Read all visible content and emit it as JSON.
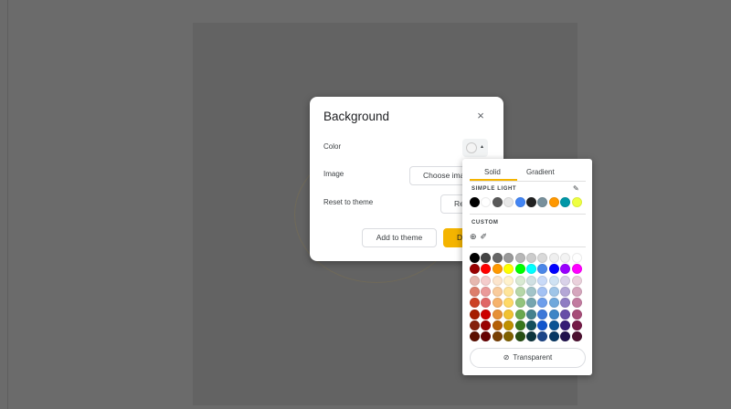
{
  "dialog": {
    "title": "Background",
    "close_icon": "×",
    "rows": {
      "color_label": "Color",
      "image_label": "Image",
      "reset_label": "Reset to theme"
    },
    "choose_image_label": "Choose ima",
    "reset_button_label": "Re",
    "add_to_theme_label": "Add to theme",
    "done_label": "D",
    "caret": "▴"
  },
  "picker": {
    "tabs": [
      "Solid",
      "Gradient"
    ],
    "simple_light_heading": "SIMPLE LIGHT",
    "pencil_icon": "✎",
    "theme_colors": [
      "#000000",
      "#ffffff",
      "#595959",
      "#e8e8e8",
      "#4285f4",
      "#212121",
      "#78909c",
      "#ff9800",
      "#0097a7",
      "#eeff41"
    ],
    "custom_heading": "CUSTOM",
    "add_custom_icon": "⊕",
    "eyedropper_icon": "✐",
    "grid": [
      [
        "#000000",
        "#434343",
        "#666666",
        "#999999",
        "#b7b7b7",
        "#cccccc",
        "#d9d9d9",
        "#efefef",
        "#f3f3f3",
        "#ffffff"
      ],
      [
        "#980000",
        "#ff0000",
        "#ff9900",
        "#ffff00",
        "#00ff00",
        "#00ffff",
        "#4a86e8",
        "#0000ff",
        "#9900ff",
        "#ff00ff"
      ],
      [
        "#e6b8af",
        "#f4cccc",
        "#fce5cd",
        "#fff2cc",
        "#d9ead3",
        "#d0e0e3",
        "#c9daf8",
        "#cfe2f3",
        "#d9d2e9",
        "#ead1dc"
      ],
      [
        "#dd7e6b",
        "#ea9999",
        "#f9cb9c",
        "#ffe599",
        "#b6d7a8",
        "#a2c4c9",
        "#a4c2f4",
        "#9fc5e8",
        "#b4a7d6",
        "#d5a6bd"
      ],
      [
        "#cc4125",
        "#e06666",
        "#f6b26b",
        "#ffd966",
        "#93c47d",
        "#76a5af",
        "#6d9eeb",
        "#6fa8dc",
        "#8e7cc3",
        "#c27ba0"
      ],
      [
        "#a61c00",
        "#cc0000",
        "#e69138",
        "#f1c232",
        "#6aa84f",
        "#45818e",
        "#3c78d8",
        "#3d85c6",
        "#674ea7",
        "#a64d79"
      ],
      [
        "#85200c",
        "#990000",
        "#b45f06",
        "#bf9000",
        "#38761d",
        "#134f5c",
        "#1155cc",
        "#0b5394",
        "#351c75",
        "#741b47"
      ],
      [
        "#5b0f00",
        "#660000",
        "#783f04",
        "#7f6000",
        "#274e13",
        "#0c343d",
        "#1c4587",
        "#073763",
        "#20124d",
        "#4c1130"
      ]
    ],
    "transparent_icon": "⊘",
    "transparent_label": "Transparent"
  }
}
